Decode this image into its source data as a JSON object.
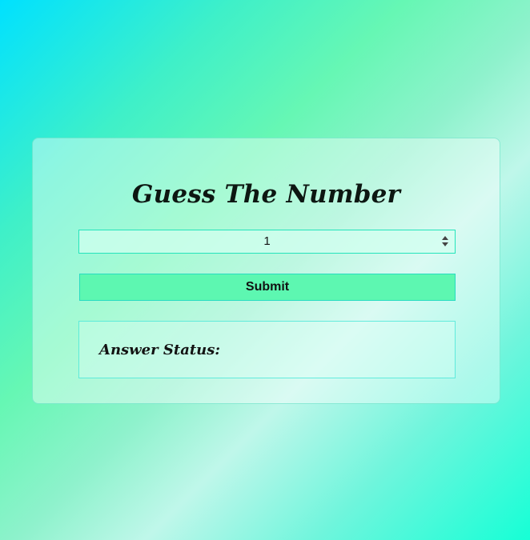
{
  "title": "Guess The Number",
  "guess_input": {
    "value": "1"
  },
  "submit_label": "Submit",
  "status_label": "Answer Status:"
}
